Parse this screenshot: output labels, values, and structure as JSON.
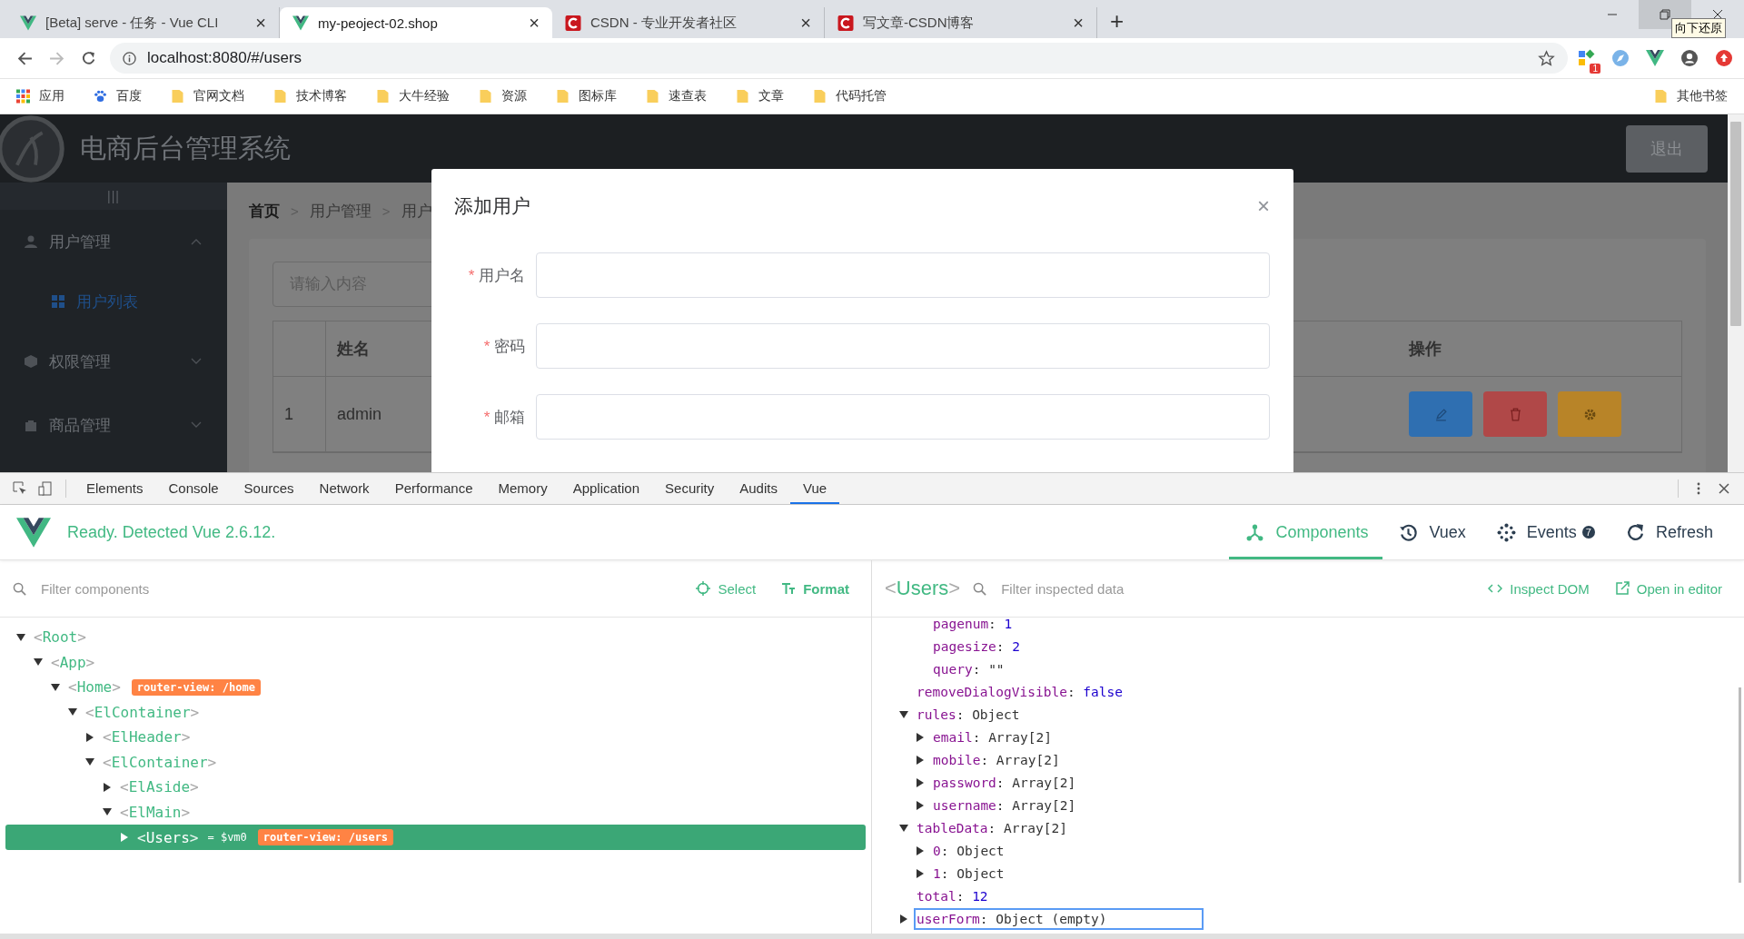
{
  "browser": {
    "tabs": [
      {
        "title": "[Beta] serve - 任务 - Vue CLI",
        "kind": "vue",
        "selected": false,
        "close": "×"
      },
      {
        "title": "my-peoject-02.shop",
        "kind": "vue",
        "selected": true,
        "close": "×"
      },
      {
        "title": "CSDN - 专业开发者社区",
        "kind": "csdn",
        "selected": false,
        "close": "×"
      },
      {
        "title": "写文章-CSDN博客",
        "kind": "csdn",
        "selected": false,
        "close": "×"
      }
    ],
    "new_tab": "+",
    "tooltip": "向下还原",
    "address": "localhost:8080/#/users",
    "extension_badge": "1",
    "bookmarks": [
      {
        "label": "应用",
        "kind": "apps"
      },
      {
        "label": "百度",
        "kind": "paw"
      },
      {
        "label": "官网文档",
        "kind": "folder"
      },
      {
        "label": "技术博客",
        "kind": "folder"
      },
      {
        "label": "大牛经验",
        "kind": "folder"
      },
      {
        "label": "资源",
        "kind": "folder"
      },
      {
        "label": "图标库",
        "kind": "folder"
      },
      {
        "label": "速查表",
        "kind": "folder"
      },
      {
        "label": "文章",
        "kind": "folder"
      },
      {
        "label": "代码托管",
        "kind": "folder"
      }
    ],
    "other_bookmarks": "其他书签"
  },
  "app": {
    "title": "电商后台管理系统",
    "logout": "退出",
    "toggle": "|||",
    "menu": [
      {
        "label": "用户管理",
        "kind": "user",
        "expanded": true,
        "children": [
          {
            "label": "用户列表",
            "selected": true
          }
        ]
      },
      {
        "label": "权限管理",
        "kind": "box",
        "expanded": false
      },
      {
        "label": "商品管理",
        "kind": "bag",
        "expanded": false
      }
    ],
    "breadcrumb": [
      "首页",
      "用户管理",
      "用户"
    ],
    "breadcrumb_separator": ">",
    "search": {
      "placeholder": "请输入内容"
    },
    "table": {
      "columns": [
        "姓名",
        "操作"
      ],
      "rows": [
        {
          "index": "1",
          "name": "admin"
        }
      ]
    },
    "dialog": {
      "title": "添加用户",
      "close": "×",
      "fields": [
        {
          "required_mark": "*",
          "label": "用户名"
        },
        {
          "required_mark": "*",
          "label": "密码"
        },
        {
          "required_mark": "*",
          "label": "邮箱"
        }
      ]
    }
  },
  "devtools": {
    "tabs": [
      {
        "label": "Elements",
        "selected": false
      },
      {
        "label": "Console",
        "selected": false
      },
      {
        "label": "Sources",
        "selected": false
      },
      {
        "label": "Network",
        "selected": false
      },
      {
        "label": "Performance",
        "selected": false
      },
      {
        "label": "Memory",
        "selected": false
      },
      {
        "label": "Application",
        "selected": false
      },
      {
        "label": "Security",
        "selected": false
      },
      {
        "label": "Audits",
        "selected": false
      },
      {
        "label": "Vue",
        "selected": true
      }
    ],
    "status": "Ready. Detected Vue 2.6.12.",
    "nav": [
      {
        "label": "Components",
        "kind": "components",
        "selected": true
      },
      {
        "label": "Vuex",
        "kind": "history",
        "selected": false
      },
      {
        "label": "Events",
        "kind": "events",
        "selected": false,
        "badge": "7"
      },
      {
        "label": "Refresh",
        "kind": "refresh",
        "selected": false
      }
    ],
    "filter_components": {
      "placeholder": "Filter components"
    },
    "select": "Select",
    "format": "Format",
    "inspected": "<Users>",
    "filter_inspected": {
      "placeholder": "Filter inspected data"
    },
    "inspect_dom": "Inspect DOM",
    "open_in_editor": "Open in editor",
    "tree": [
      {
        "label": "<Root>",
        "expanded": true,
        "selected": false,
        "children": [
          {
            "label": "<App>",
            "expanded": true,
            "selected": false,
            "children": [
              {
                "label": "<Home>",
                "expanded": true,
                "selected": false,
                "tag": "router-view: /home",
                "children": [
                  {
                    "label": "<ElContainer>",
                    "expanded": true,
                    "selected": false,
                    "children": [
                      {
                        "label": "<ElHeader>",
                        "expanded": false,
                        "selected": false
                      },
                      {
                        "label": "<ElContainer>",
                        "expanded": true,
                        "selected": false,
                        "children": [
                          {
                            "label": "<ElAside>",
                            "expanded": false,
                            "selected": false
                          },
                          {
                            "label": "<ElMain>",
                            "expanded": true,
                            "selected": false,
                            "children": [
                              {
                                "label": "<Users>",
                                "expanded": false,
                                "selected": true,
                                "vm": "= $vm0",
                                "tag": "router-view: /users"
                              }
                            ]
                          }
                        ]
                      }
                    ]
                  }
                ]
              }
            ]
          }
        ]
      }
    ],
    "separator": ":",
    "state_continued": [
      {
        "key": "pagenum",
        "value": "1",
        "kind": "number"
      },
      {
        "key": "pagesize",
        "value": "2",
        "kind": "number"
      },
      {
        "key": "query",
        "value": "\"\"",
        "kind": "string"
      }
    ],
    "state": [
      {
        "key": "removeDialogVisible",
        "value": "false",
        "kind": "keyword",
        "selected": false
      },
      {
        "key": "rules",
        "value": "Object",
        "kind": "plain",
        "expanded": true,
        "selected": false,
        "children": [
          {
            "key": "email",
            "value": "Array[2]"
          },
          {
            "key": "mobile",
            "value": "Array[2]"
          },
          {
            "key": "password",
            "value": "Array[2]"
          },
          {
            "key": "username",
            "value": "Array[2]"
          }
        ]
      },
      {
        "key": "tableData",
        "value": "Array[2]",
        "kind": "plain",
        "expanded": true,
        "selected": false,
        "children": [
          {
            "key": "0",
            "value": "Object"
          },
          {
            "key": "1",
            "value": "Object"
          }
        ]
      },
      {
        "key": "total",
        "value": "12",
        "kind": "number",
        "selected": false
      },
      {
        "key": "userForm",
        "value": "Object (empty)",
        "kind": "plain",
        "expanded": false,
        "selected": true
      }
    ]
  }
}
